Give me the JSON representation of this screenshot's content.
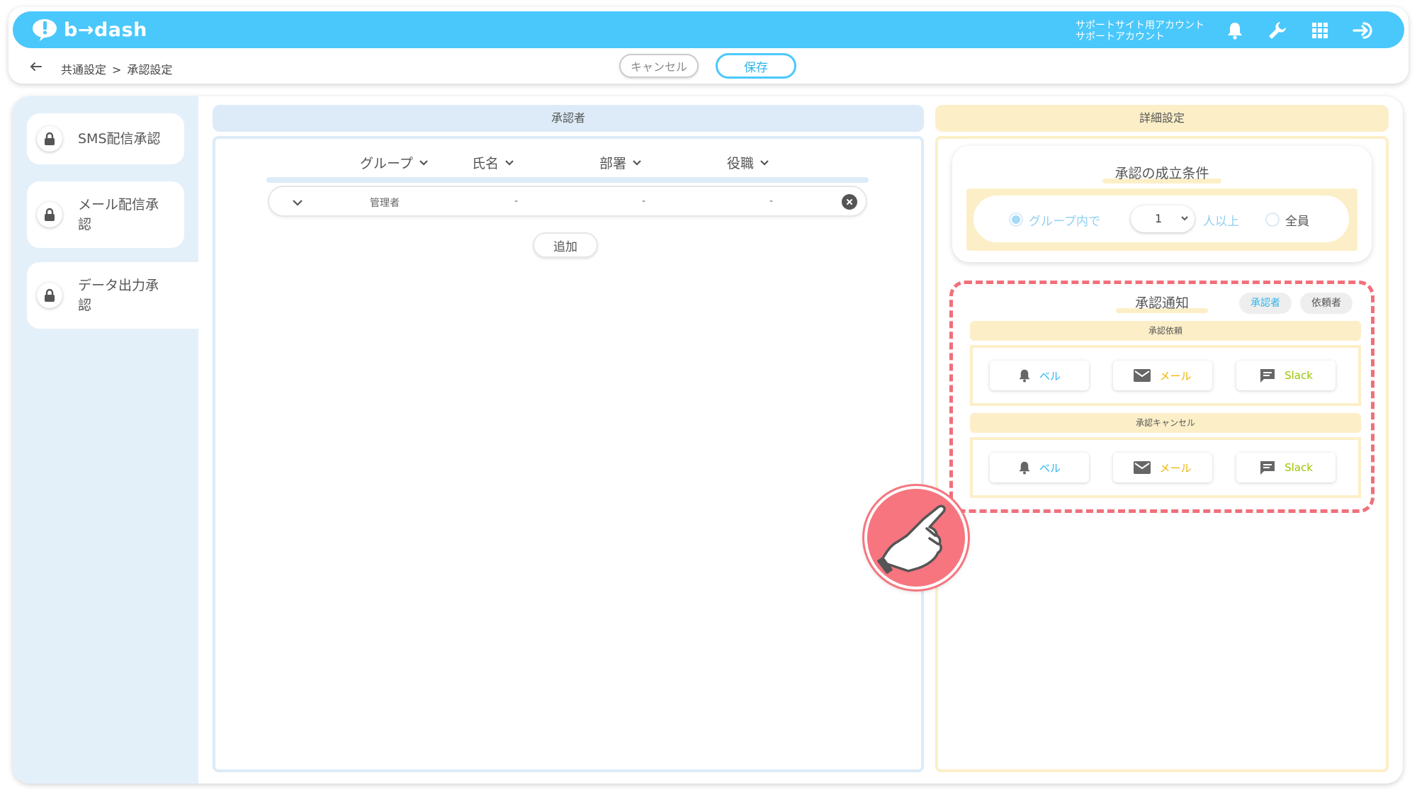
{
  "app": {
    "logo_text": "b→dash"
  },
  "header": {
    "account_line1": "サポートサイト用アカウント",
    "account_line2": "サポートアカウント"
  },
  "breadcrumb": {
    "parent": "共通設定",
    "separator": ">",
    "current": "承認設定"
  },
  "actions": {
    "cancel_label": "キャンセル",
    "save_label": "保存"
  },
  "sidebar": {
    "items": [
      {
        "label": "SMS配信承認",
        "icon": "lock-icon"
      },
      {
        "label": "メール配信承認",
        "icon": "lock-icon"
      },
      {
        "label": "データ出力承認",
        "icon": "lock-icon"
      }
    ]
  },
  "approvers": {
    "title": "承認者",
    "columns": [
      "グループ",
      "氏名",
      "部署",
      "役職"
    ],
    "rows": [
      {
        "group": "管理者",
        "name": "-",
        "department": "-",
        "position": "-"
      }
    ],
    "add_label": "追加"
  },
  "details": {
    "title": "詳細設定",
    "condition": {
      "title": "承認の成立条件",
      "option_group": "グループ内で",
      "count": "1",
      "suffix": "人以上",
      "option_all": "全員"
    },
    "notification": {
      "title": "承認通知",
      "toggle_approver": "承認者",
      "toggle_requester": "依頼者",
      "request": {
        "title": "承認依頼",
        "bell": "ベル",
        "mail": "メール",
        "slack": "Slack"
      },
      "cancel": {
        "title": "承認キャンセル",
        "bell": "ベル",
        "mail": "メール",
        "slack": "Slack"
      }
    }
  },
  "colors": {
    "header": "#4ac8fb",
    "accent_blue": "#2fb5ec",
    "panel_blue": "#dcebf7",
    "panel_yellow": "#fcefc8",
    "mail_orange": "#f0b400",
    "slack_green": "#9bc400",
    "highlight_red": "#f0707a"
  }
}
